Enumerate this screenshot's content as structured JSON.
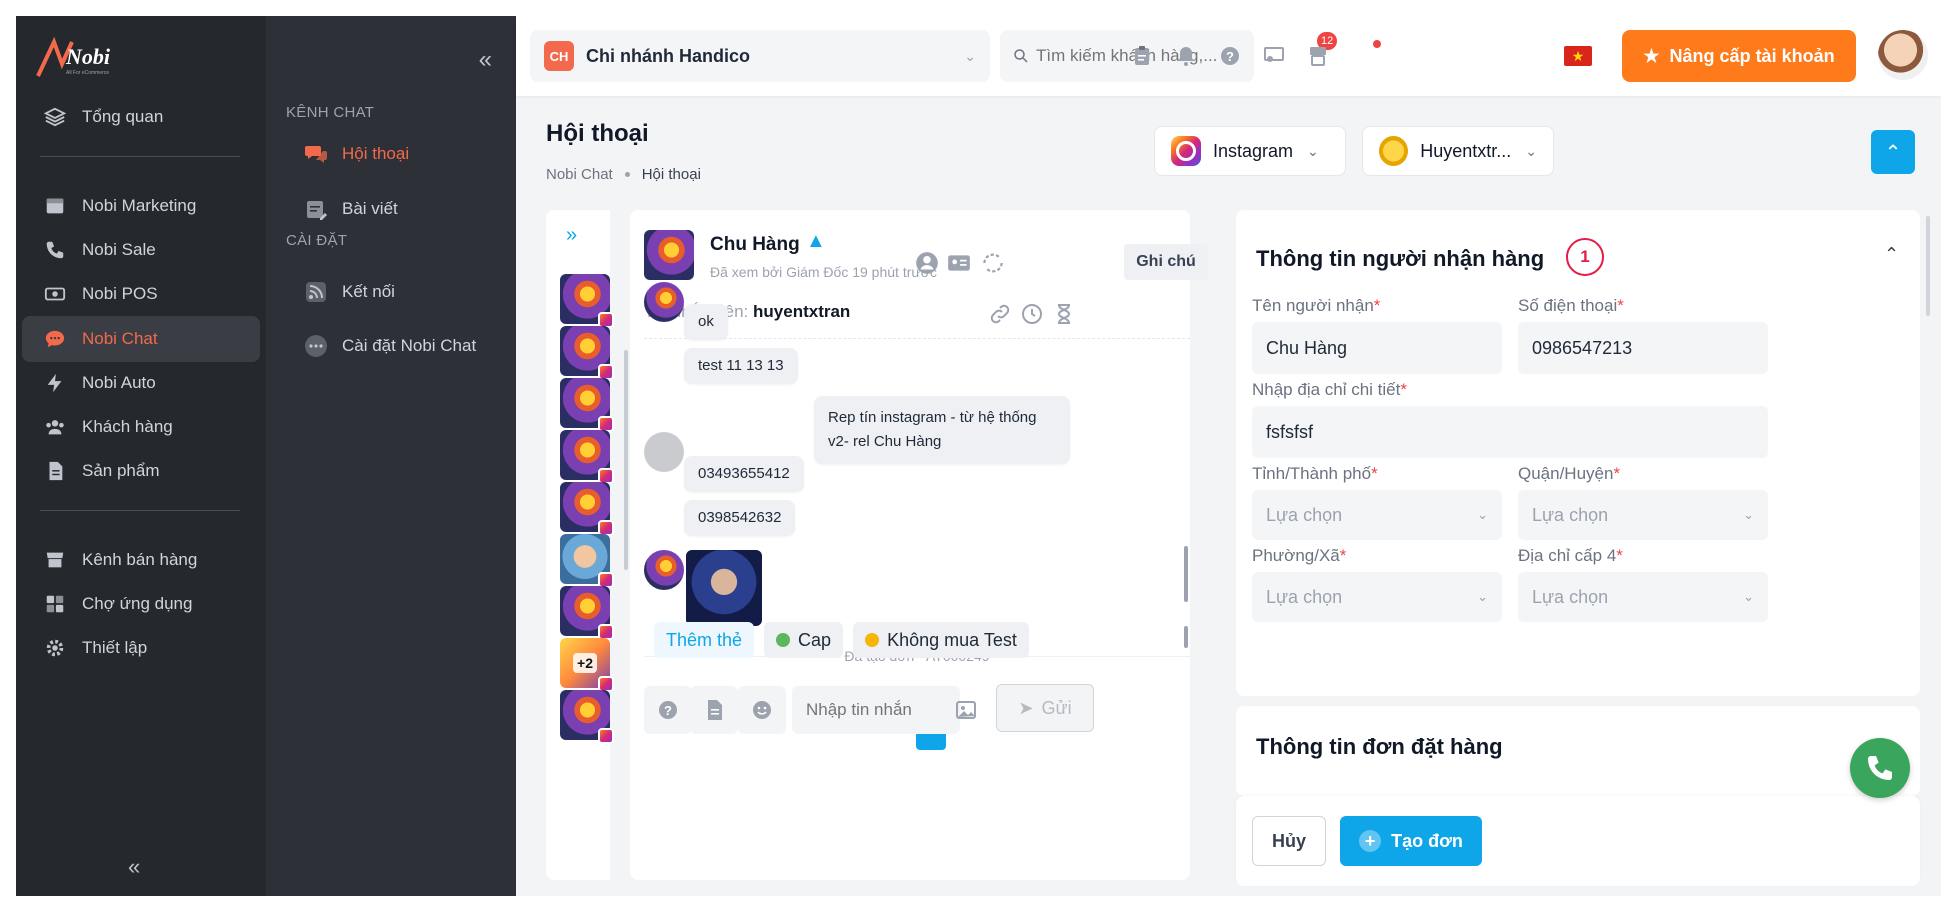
{
  "brand": {
    "logo_text": "Nobi",
    "logo_tagline": "All For eCommerce"
  },
  "sidebar": {
    "items": [
      {
        "label": "Tổng quan",
        "icon": "layers-icon"
      },
      {
        "label": "Nobi Marketing",
        "icon": "inbox-icon"
      },
      {
        "label": "Nobi Sale",
        "icon": "phone-icon"
      },
      {
        "label": "Nobi POS",
        "icon": "money-icon"
      },
      {
        "label": "Nobi Chat",
        "icon": "chat-icon",
        "active": true
      },
      {
        "label": "Nobi Auto",
        "icon": "bolt-icon"
      },
      {
        "label": "Khách hàng",
        "icon": "users-icon"
      },
      {
        "label": "Sản phẩm",
        "icon": "document-icon"
      },
      {
        "label": "Kênh bán hàng",
        "icon": "store-icon"
      },
      {
        "label": "Chợ ứng dụng",
        "icon": "apps-icon"
      },
      {
        "label": "Thiết lập",
        "icon": "gear-icon"
      }
    ],
    "collapse": "«"
  },
  "subpanel": {
    "collapse": "«",
    "section_chat": "KÊNH CHAT",
    "section_settings": "CÀI ĐẶT",
    "items": [
      {
        "label": "Hội thoại",
        "active": true
      },
      {
        "label": "Bài viết"
      },
      {
        "label": "Kết nối"
      },
      {
        "label": "Cài đặt Nobi Chat"
      }
    ]
  },
  "header": {
    "branch_initials": "CH",
    "branch_name": "Chi nhánh Handico",
    "search_placeholder": "Tìm kiếm khách hàng,...",
    "task_count": "12",
    "flag": "★",
    "upgrade_label": "Nâng cấp tài khoản"
  },
  "page": {
    "title": "Hội thoại",
    "breadcrumb": [
      "Nobi Chat",
      "Hội thoại"
    ],
    "channel": "Instagram",
    "account": "Huyentxtr..."
  },
  "conversations": {
    "expand": "»",
    "more_count": "+2"
  },
  "chat": {
    "name": "Chu Hàng",
    "seen": "Đã xem bởi Giám Đốc 19 phút trước",
    "note_label": "Ghi chú",
    "via_label": "Tin nhắn trên:",
    "via_account": "huyentxtran",
    "messages": [
      "ok",
      "test 11 13 13",
      "Rep tín instagram - từ hệ thống v2- rel Chu Hàng",
      "03493655412",
      "0398542632"
    ],
    "order_created": "Đã tạo đơn - AT000249",
    "tags": [
      {
        "label": "Thêm thẻ"
      },
      {
        "label": "Cap",
        "color": "#5cb85c"
      },
      {
        "label": "Không mua Test",
        "color": "#f5b50a"
      }
    ],
    "input_placeholder": "Nhập tin nhắn",
    "send_label": "Gửi"
  },
  "form": {
    "title": "Thông tin người nhận hàng",
    "step": "1",
    "fields": {
      "name_label": "Tên người nhận",
      "name_value": "Chu Hàng",
      "phone_label": "Số điện thoại",
      "phone_value": "0986547213",
      "address_label": "Nhập địa chỉ chi tiết",
      "address_value": "fsfsfsf",
      "province_label": "Tỉnh/Thành phố",
      "district_label": "Quận/Huyện",
      "ward_label": "Phường/Xã",
      "level4_label": "Địa chỉ cấp 4",
      "select_placeholder": "Lựa chọn",
      "required_mark": "*"
    }
  },
  "order": {
    "title": "Thông tin đơn đặt hàng"
  },
  "actions": {
    "cancel": "Hủy",
    "create": "Tạo đơn"
  },
  "colors": {
    "accent": "#0ea5e9",
    "brand": "#f26a4b",
    "upgrade": "#ff7a1a"
  }
}
